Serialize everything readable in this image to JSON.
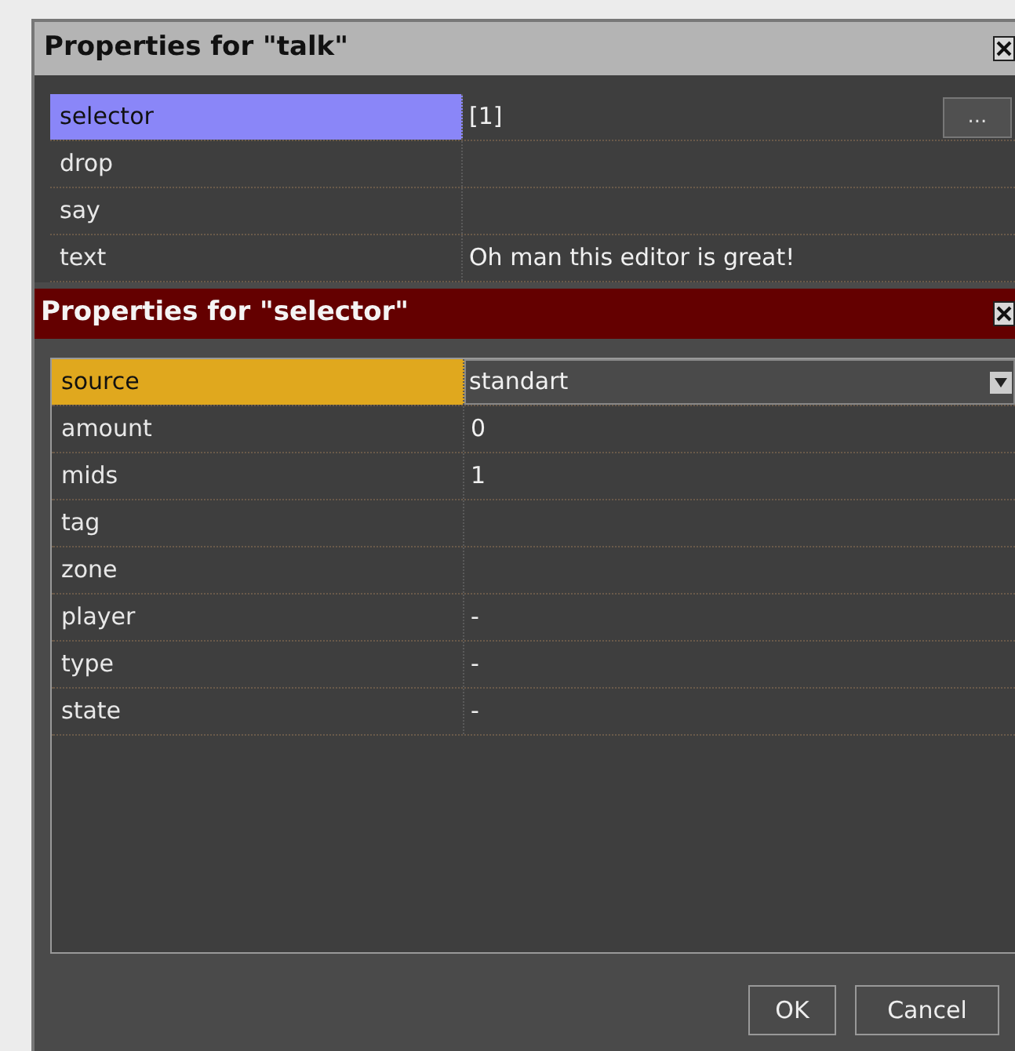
{
  "outer_dialog": {
    "title": "Properties for \"talk\"",
    "properties": [
      {
        "name": "selector",
        "value": "[1]",
        "selected": true,
        "kind": "button",
        "button_label": "..."
      },
      {
        "name": "drop",
        "selected": false,
        "kind": "text"
      },
      {
        "name": "say",
        "selected": false,
        "kind": "text"
      },
      {
        "name": "text",
        "value": "Oh man this editor is great!",
        "selected": false,
        "kind": "text"
      }
    ]
  },
  "inner_dialog": {
    "title": "Properties for \"selector\"",
    "properties": [
      {
        "name": "source",
        "value": "standart",
        "selected": true,
        "kind": "dropdown"
      },
      {
        "name": "amount",
        "value": "0",
        "selected": false,
        "kind": "text"
      },
      {
        "name": "mids",
        "value": "1",
        "selected": false,
        "kind": "text"
      },
      {
        "name": "tag",
        "selected": false,
        "kind": "text"
      },
      {
        "name": "zone",
        "selected": false,
        "kind": "text"
      },
      {
        "name": "player",
        "value": "-",
        "selected": false,
        "kind": "text"
      },
      {
        "name": "type",
        "value": "-",
        "selected": false,
        "kind": "text"
      },
      {
        "name": "state",
        "value": "-",
        "selected": false,
        "kind": "text"
      }
    ],
    "buttons": [
      "OK",
      "Cancel"
    ]
  }
}
